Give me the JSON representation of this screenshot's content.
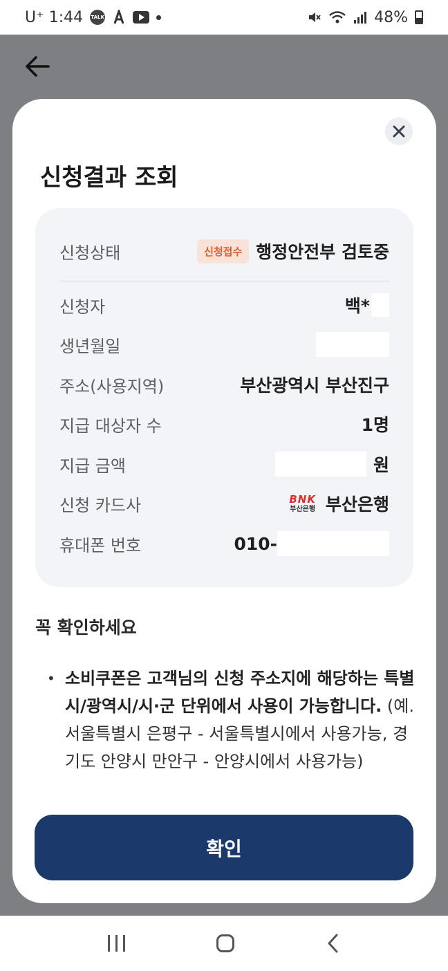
{
  "status_bar": {
    "carrier_time": "U⁺ 1:44",
    "talk_icon_label": "TALK",
    "battery": "48%"
  },
  "modal": {
    "title": "신청결과 조회",
    "close_icon": "close-icon",
    "rows": [
      {
        "label": "신청상태",
        "badge": "신청접수",
        "value": "행정안전부 검토중"
      },
      {
        "label": "신청자",
        "value": "백*"
      },
      {
        "label": "생년월일",
        "value": ""
      },
      {
        "label": "주소(사용지역)",
        "value": "부산광역시 부산진구"
      },
      {
        "label": "지급 대상자 수",
        "value": "1명"
      },
      {
        "label": "지급 금액",
        "value": "원"
      },
      {
        "label": "신청 카드사",
        "logo_text": "BNK",
        "logo_sub": "부산은행",
        "value": "부산은행"
      },
      {
        "label": "휴대폰 번호",
        "value": "010-"
      }
    ],
    "notice": {
      "title": "꼭 확인하세요",
      "bold_text": "소비쿠폰은 고객님의 신청 주소지에 해당하는 특별시/광역시/시·군 단위에서 사용이 가능합니다.",
      "normal_text": " (예. 서울특별시 은평구 - 서울특별시에서 사용가능, 경기도 안양시 만안구 - 안양시에서 사용가능)"
    },
    "confirm_label": "확인"
  },
  "colors": {
    "overlay": "#7e7f82",
    "confirm_button": "#1b3a6b",
    "badge_bg": "#f9e2d9",
    "badge_text": "#e15f2e",
    "card_bg": "#f3f4f8"
  }
}
